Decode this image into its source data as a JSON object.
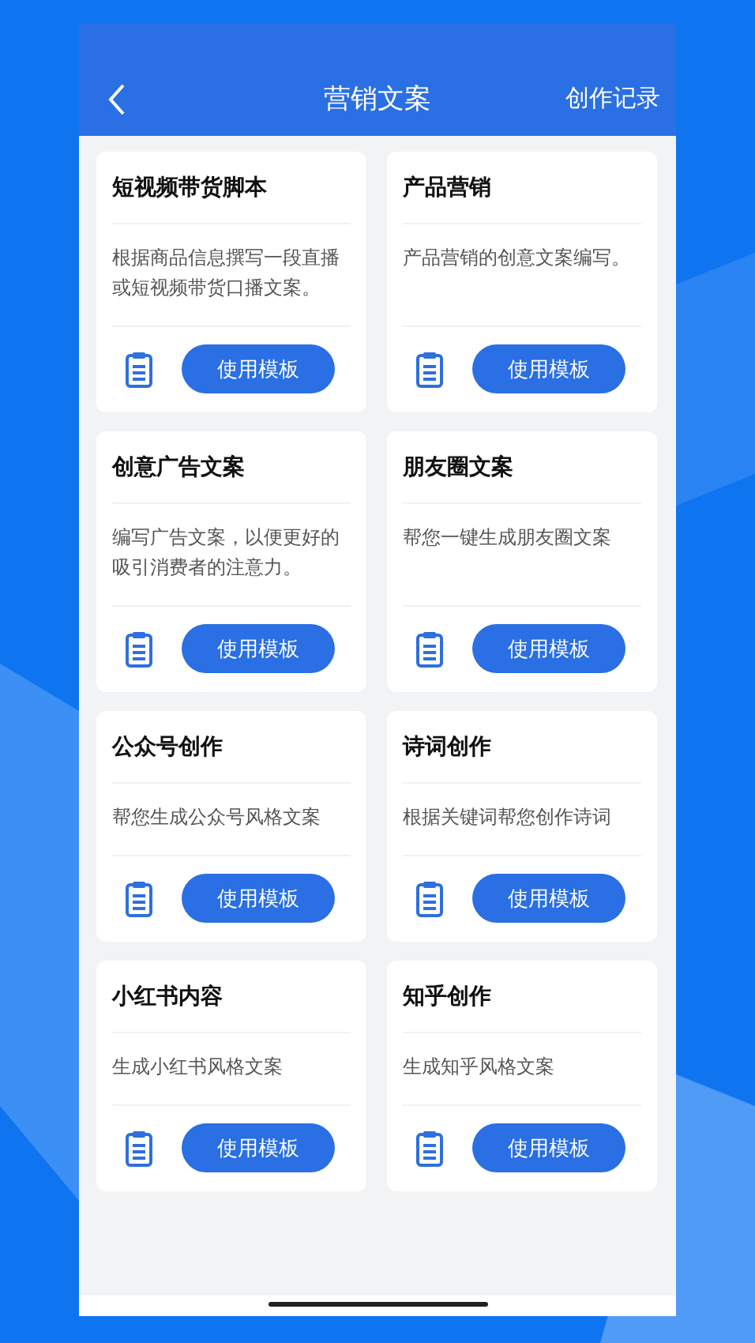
{
  "header": {
    "title": "营销文案",
    "action": "创作记录"
  },
  "cards": [
    {
      "title": "短视频带货脚本",
      "description": "根据商品信息撰写一段直播或短视频带货口播文案。",
      "button": "使用模板"
    },
    {
      "title": "产品营销",
      "description": "产品营销的创意文案编写。",
      "button": "使用模板"
    },
    {
      "title": "创意广告文案",
      "description": "编写广告文案，以便更好的吸引消费者的注意力。",
      "button": "使用模板"
    },
    {
      "title": "朋友圈文案",
      "description": "帮您一键生成朋友圈文案",
      "button": "使用模板"
    },
    {
      "title": "公众号创作",
      "description": "帮您生成公众号风格文案",
      "button": "使用模板"
    },
    {
      "title": "诗词创作",
      "description": "根据关键词帮您创作诗词",
      "button": "使用模板"
    },
    {
      "title": "小红书内容",
      "description": "生成小红书风格文案",
      "button": "使用模板"
    },
    {
      "title": "知乎创作",
      "description": "生成知乎风格文案",
      "button": "使用模板"
    }
  ]
}
